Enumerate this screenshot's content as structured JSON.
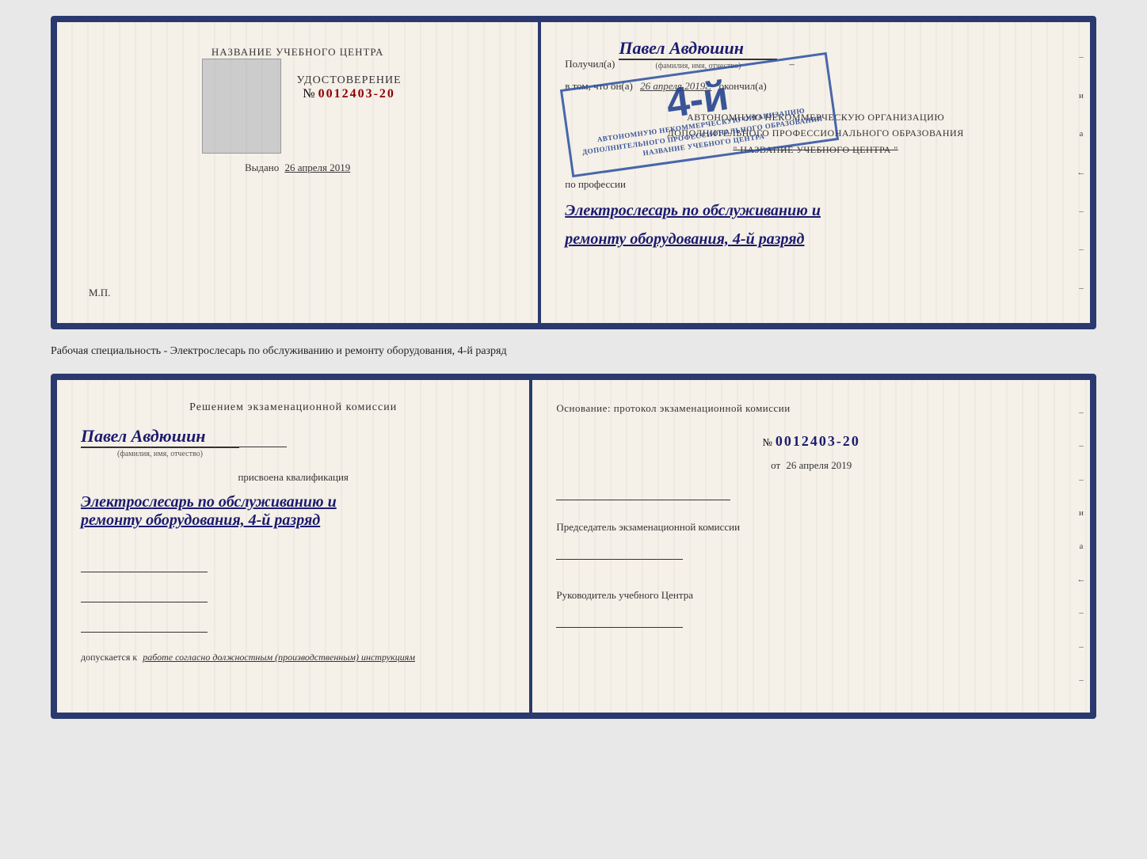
{
  "top_doc": {
    "left": {
      "title": "НАЗВАНИЕ УЧЕБНОГО ЦЕНТРА",
      "cert_label": "УДОСТОВЕРЕНИЕ",
      "cert_number_prefix": "№",
      "cert_number": "0012403-20",
      "vydano_label": "Выдано",
      "vydano_date": "26 апреля 2019",
      "mp_label": "М.П."
    },
    "right": {
      "poluchil_label": "Получил(а)",
      "name_handwritten": "Павел Авдюшин",
      "fio_subtext": "(фамилия, имя, отчество)",
      "dash": "–",
      "vtom_label": "в том, что он(а)",
      "date_handwritten": "26 апреля 2019г.",
      "okonchil_label": "окончил(а)",
      "org_line1": "АВТОНОМНУЮ НЕКОММЕРЧЕСКУЮ ОРГАНИЗАЦИЮ",
      "org_line2": "ДОПОЛНИТЕЛЬНОГО ПРОФЕССИОНАЛЬНОГО ОБРАЗОВАНИЯ",
      "org_line3": "\" НАЗВАНИЕ УЧЕБНОГО ЦЕНТРА \"",
      "po_professii_label": "по профессии",
      "profession_line1": "Электрослесарь по обслуживанию и",
      "profession_line2": "ремонту оборудования, 4-й разряд"
    },
    "stamp": {
      "big_number": "4-й",
      "line1": "АВТОНОМНУЮ НЕКОММЕРЧЕСКУЮ ОРГАНИЗАЦИЮ",
      "line2": "ДОПОЛНИТЕЛЬНОГО ПРОФЕССИОНАЛЬНОГО ОБРАЗОВАНИЯ",
      "line3": "НАЗВАНИЕ УЧЕБНОГО ЦЕНТРА"
    },
    "side_chars": [
      "–",
      "и",
      "а",
      "←",
      "–",
      "–",
      "–"
    ]
  },
  "subtitle": "Рабочая специальность - Электрослесарь по обслуживанию и ремонту оборудования, 4-й разряд",
  "bottom_doc": {
    "left": {
      "resheniem_title": "Решением экзаменационной комиссии",
      "name_handwritten": "Павел Авдюшин",
      "fio_subtext": "(фамилия, имя, отчество)",
      "prisvoen_label": "присвоена квалификация",
      "profession_line1": "Электрослесарь по обслуживанию и",
      "profession_line2": "ремонту оборудования, 4-й разряд",
      "dopuskaetsya_label": "допускается к",
      "dopuskaetsya_text": "работе согласно должностным (производственным) инструкциям"
    },
    "right": {
      "osnov_label": "Основание: протокол экзаменационной комиссии",
      "number_prefix": "№",
      "protocol_number": "0012403-20",
      "ot_label": "от",
      "ot_date": "26 апреля 2019",
      "predsedatel_label": "Председатель экзаменационной комиссии",
      "rukov_label": "Руководитель учебного Центра"
    },
    "side_chars": [
      "–",
      "–",
      "–",
      "и",
      "а",
      "←",
      "–",
      "–",
      "–"
    ]
  }
}
